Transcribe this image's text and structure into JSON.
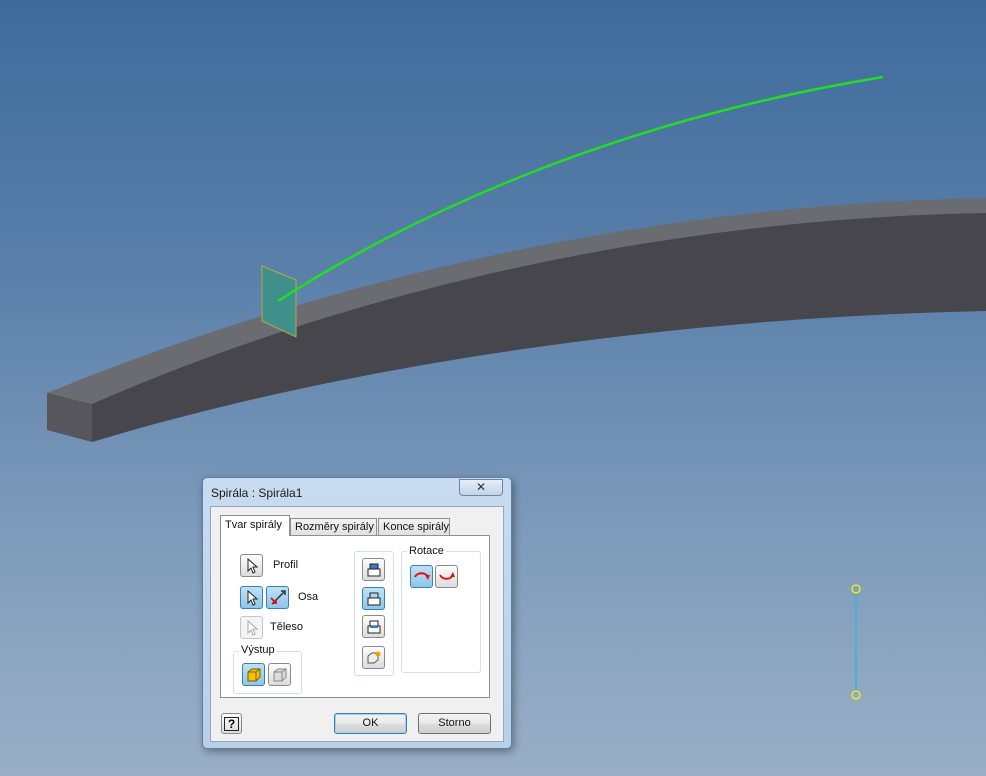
{
  "dialog": {
    "title": "Spirála : Spirála1",
    "close_glyph": "✕",
    "tabs": [
      {
        "label": "Tvar spirály"
      },
      {
        "label": "Rozměry spirály"
      },
      {
        "label": "Konce spirály"
      }
    ],
    "shape_tab": {
      "profile_label": "Profil",
      "axis_label": "Osa",
      "solid_label": "Těleso",
      "output_group_title": "Výstup",
      "rotation_group_title": "Rotace"
    },
    "buttons": {
      "ok_label": "OK",
      "cancel_label": "Storno",
      "help_glyph": "?"
    }
  },
  "colors": {
    "path_curve": "#22dd22",
    "profile_face": "#3f8f8a",
    "rotation_arrow": "#e01010",
    "axis_line": "#30b8d8",
    "axis_point": "#e8e820"
  },
  "icons": {
    "profile": "select-arrow-icon",
    "axis": "select-arrow-icon",
    "axis_flip": "flip-direction-icon",
    "solid": "select-arrow-icon",
    "output_solid": "solid-cube-icon",
    "output_surface": "surface-cube-icon",
    "op_join": "join-icon",
    "op_cut": "cut-icon",
    "op_intersect": "intersect-icon",
    "op_new_solid": "new-solid-icon",
    "rot_clockwise": "rotate-clockwise-icon",
    "rot_counter": "rotate-counterclockwise-icon"
  }
}
